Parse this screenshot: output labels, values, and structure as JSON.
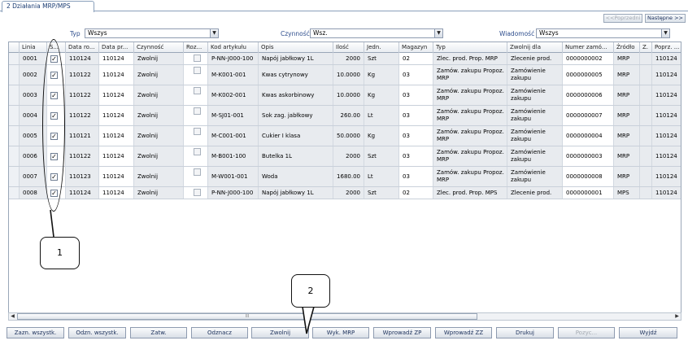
{
  "tab": {
    "label": "2 Działania MRP/MPS"
  },
  "nav": {
    "prev_label": "<<Poprzedni",
    "next_label": "Następne >>"
  },
  "filters": {
    "typ_label": "Typ",
    "typ_value": "Wszys",
    "czynnosc_label": "Czynność",
    "czynnosc_value": "Wsz.",
    "wiadomosc_label": "Wiadomość",
    "wiadomosc_value": "Wszys"
  },
  "table": {
    "headers": [
      "Linia",
      "S...",
      "Data ro...",
      "Data pr...",
      "Czynność",
      "Roz...",
      "Kod artykułu",
      "Opis",
      "Ilość",
      "Jedn.",
      "Magazyn",
      "Typ",
      "Zwolnij dla",
      "Numer zamó...",
      "Źródło",
      "Z.",
      "Poprz. ..."
    ],
    "rows": [
      {
        "linia": "0001",
        "checked": true,
        "data_ro": "110124",
        "data_pr": "110124",
        "czynnosc": "Zwolnij",
        "kod": "P-NN-J000-100",
        "opis": "Napój jabłkowy 1L",
        "ilosc": "2000",
        "jedn": "Szt",
        "magazyn": "02",
        "typ": "Zlec. prod. Prop. MRP",
        "zwolnij": "Zlecenie prod.",
        "numer": "0000000002",
        "zrodlo": "MRP",
        "poprz": "110124"
      },
      {
        "linia": "0002",
        "checked": true,
        "data_ro": "110122",
        "data_pr": "110124",
        "czynnosc": "Zwolnij",
        "kod": "M-K001-001",
        "opis": "Kwas cytrynowy",
        "ilosc": "10.0000",
        "jedn": "Kg",
        "magazyn": "03",
        "typ": "Zamów. zakupu Propoz. MRP",
        "zwolnij": "Zamówienie zakupu",
        "numer": "0000000005",
        "zrodlo": "MRP",
        "poprz": "110124"
      },
      {
        "linia": "0003",
        "checked": true,
        "data_ro": "110122",
        "data_pr": "110124",
        "czynnosc": "Zwolnij",
        "kod": "M-K002-001",
        "opis": "Kwas askorbinowy",
        "ilosc": "10.0000",
        "jedn": "Kg",
        "magazyn": "03",
        "typ": "Zamów. zakupu Propoz. MRP",
        "zwolnij": "Zamówienie zakupu",
        "numer": "0000000006",
        "zrodlo": "MRP",
        "poprz": "110124"
      },
      {
        "linia": "0004",
        "checked": true,
        "data_ro": "110122",
        "data_pr": "110124",
        "czynnosc": "Zwolnij",
        "kod": "M-SJ01-001",
        "opis": "Sok zag. jabłkowy",
        "ilosc": "260.00",
        "jedn": "Lt",
        "magazyn": "03",
        "typ": "Zamów. zakupu Propoz. MRP",
        "zwolnij": "Zamówienie zakupu",
        "numer": "0000000007",
        "zrodlo": "MRP",
        "poprz": "110124"
      },
      {
        "linia": "0005",
        "checked": true,
        "data_ro": "110121",
        "data_pr": "110124",
        "czynnosc": "Zwolnij",
        "kod": "M-C001-001",
        "opis": "Cukier I klasa",
        "ilosc": "50.0000",
        "jedn": "Kg",
        "magazyn": "03",
        "typ": "Zamów. zakupu Propoz. MRP",
        "zwolnij": "Zamówienie zakupu",
        "numer": "0000000004",
        "zrodlo": "MRP",
        "poprz": "110124"
      },
      {
        "linia": "0006",
        "checked": true,
        "data_ro": "110122",
        "data_pr": "110124",
        "czynnosc": "Zwolnij",
        "kod": "M-B001-100",
        "opis": "Butelka 1L",
        "ilosc": "2000",
        "jedn": "Szt",
        "magazyn": "03",
        "typ": "Zamów. zakupu Propoz. MRP",
        "zwolnij": "Zamówienie zakupu",
        "numer": "0000000003",
        "zrodlo": "MRP",
        "poprz": "110124"
      },
      {
        "linia": "0007",
        "checked": true,
        "data_ro": "110123",
        "data_pr": "110124",
        "czynnosc": "Zwolnij",
        "kod": "M-W001-001",
        "opis": "Woda",
        "ilosc": "1680.00",
        "jedn": "Lt",
        "magazyn": "03",
        "typ": "Zamów. zakupu Propoz. MRP",
        "zwolnij": "Zamówienie zakupu",
        "numer": "0000000008",
        "zrodlo": "MRP",
        "poprz": "110124"
      },
      {
        "linia": "0008",
        "checked": true,
        "data_ro": "110124",
        "data_pr": "110124",
        "czynnosc": "Zwolnij",
        "kod": "P-NN-J000-100",
        "opis": "Napój jabłkowy 1L",
        "ilosc": "2000",
        "jedn": "Szt",
        "magazyn": "02",
        "typ": "Zlec. prod. Prop. MPS",
        "zwolnij": "Zlecenie prod.",
        "numer": "0000000001",
        "zrodlo": "MPS",
        "poprz": "110124"
      }
    ]
  },
  "buttons": [
    {
      "label": "Zazn. wszystk.",
      "enabled": true
    },
    {
      "label": "Odzn. wszystk.",
      "enabled": true
    },
    {
      "label": "Zatw.",
      "enabled": true
    },
    {
      "label": "Odznacz",
      "enabled": true
    },
    {
      "label": "Zwolnij",
      "enabled": true
    },
    {
      "label": "Wyk. MRP",
      "enabled": true
    },
    {
      "label": "Wprowadź ZP",
      "enabled": true
    },
    {
      "label": "Wprowadź ZZ",
      "enabled": true
    },
    {
      "label": "Drukuj",
      "enabled": true
    },
    {
      "label": "Pozyc...",
      "enabled": false
    },
    {
      "label": "Wyjdź",
      "enabled": true
    }
  ],
  "annotations": {
    "callout1": "1",
    "callout2": "2"
  },
  "colors": {
    "accent": "#1a3c73",
    "grid_line": "#c9d0da",
    "grey_cell": "#e8ebef"
  }
}
